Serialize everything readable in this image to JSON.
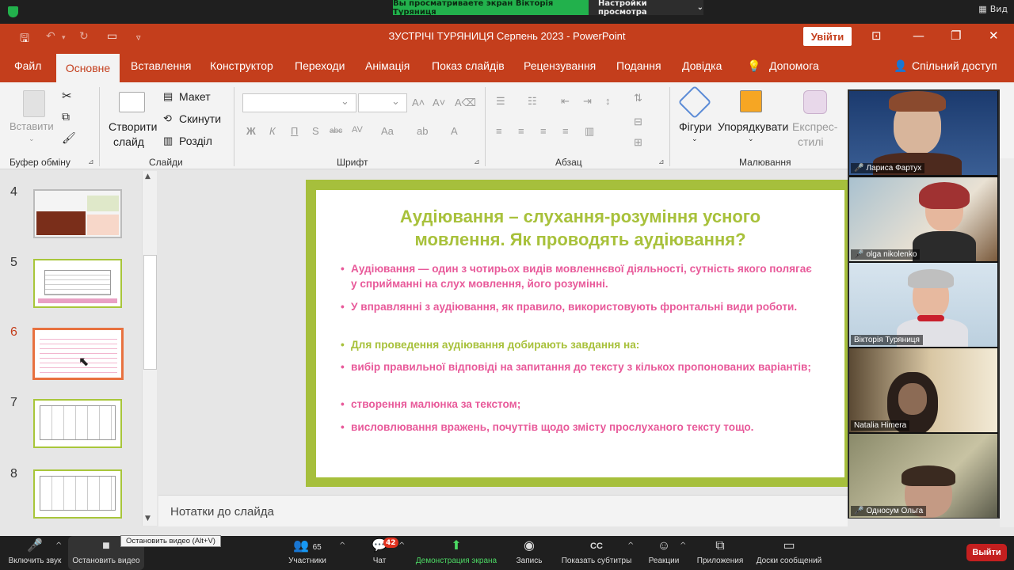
{
  "zoom": {
    "share_banner": "Вы просматриваете экран Вікторія Туряниця",
    "view_settings": "Настройки просмотра",
    "view_label": "Вид",
    "toolbar": {
      "mute": "Включить звук",
      "stop_video": "Остановить видео",
      "participants": "Участники",
      "participants_count": "65",
      "chat": "Чат",
      "chat_badge": "42",
      "share": "Демонстрация экрана",
      "record": "Запись",
      "captions": "Показать субтитры",
      "reactions": "Реакции",
      "apps": "Приложения",
      "whiteboards": "Доски сообщений",
      "end": "Выйти"
    },
    "tooltip": "Остановить видео (Alt+V)",
    "participants": [
      {
        "name": "Лариса Фартух",
        "muted": true
      },
      {
        "name": "olga nikolenko",
        "muted": true
      },
      {
        "name": "Вікторія Туряниця",
        "muted": false
      },
      {
        "name": "Natalia Himera",
        "muted": false
      },
      {
        "name": "Односум Ольга",
        "muted": true
      }
    ]
  },
  "powerpoint": {
    "title": "ЗУСТРІЧІ ТУРЯНИЦЯ Серпень 2023  -  PowerPoint",
    "signin": "Увійти",
    "tabs": [
      "Файл",
      "Основне",
      "Вставлення",
      "Конструктор",
      "Переходи",
      "Анімація",
      "Показ слайдів",
      "Рецензування",
      "Подання",
      "Довідка",
      "Допомога"
    ],
    "share": "Спільний доступ",
    "ribbon": {
      "paste": "Вставити",
      "clipboard": "Буфер обміну",
      "new_slide_1": "Створити",
      "new_slide_2": "слайд",
      "layout": "Макет",
      "reset": "Скинути",
      "section": "Розділ",
      "slides": "Слайди",
      "font": "Шрифт",
      "paragraph": "Абзац",
      "shapes": "Фігури",
      "arrange": "Упорядкувати",
      "express_1": "Експрес-",
      "express_2": "стилі",
      "drawing": "Малювання",
      "font_buttons": [
        "Ж",
        "К",
        "П",
        "S",
        "abc",
        "AV",
        "Aa",
        "A"
      ]
    },
    "slide_numbers": [
      "4",
      "5",
      "6",
      "7",
      "8"
    ],
    "active_slide": "6",
    "notes_placeholder": "Нотатки до слайда",
    "slide": {
      "title_line1": "Аудіювання – слухання-розуміння усного",
      "title_line2": "мовлення. Як проводять аудіювання?",
      "bullets": [
        {
          "text": "Аудіювання — один з чотирьох видів мовленнєвої діяльності, сутність якого полягає у сприйманні на слух мовлення, його розумінні.",
          "color": "pink"
        },
        {
          "text": "У вправлянні з аудіювання, як правило, використовують фронтальні види роботи.",
          "color": "pink"
        },
        {
          "text": "Для проведення аудіювання добирають завдання на:",
          "color": "green"
        },
        {
          "text": "вибір правильної відповіді на запитання до тексту з кількох пропонованих варіантів;",
          "color": "pink"
        },
        {
          "text": "створення малюнка за текстом;",
          "color": "pink"
        },
        {
          "text": "висловлювання вражень, почуттів щодо змісту прослуханого тексту тощо.",
          "color": "pink"
        }
      ]
    }
  },
  "colors": {
    "ppt_accent": "#c43e1c",
    "slide_green": "#a8c13b",
    "slide_pink": "#e85a9a",
    "zoom_green": "#22b14c",
    "end_red": "#c41f1f"
  }
}
